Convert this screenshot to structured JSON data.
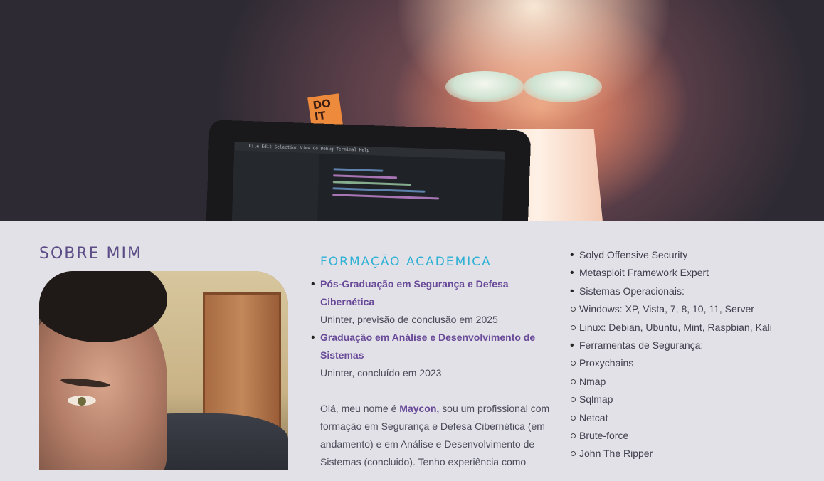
{
  "hero": {
    "postit_text": "DO IT",
    "editor_menu": "File  Edit  Selection  View  Go  Debug  Terminal  Help"
  },
  "about": {
    "title": "SOBRE MIM"
  },
  "education": {
    "title": "FORMAÇÃO ACADEMICA",
    "items": [
      {
        "degree": "Pós-Graduação em Segurança e Defesa Cibernética",
        "detail": "Uninter, previsão de conclusão em 2025"
      },
      {
        "degree": "Graduação em Análise e Desenvolvimento de Sistemas",
        "detail": "Uninter, concluído em 2023"
      }
    ],
    "bio_prefix": "Olá, meu nome é ",
    "bio_name": "Maycon,",
    "bio_rest": " sou um profissional com formação em Segurança e Defesa Cibernética (em andamento) e em Análise e Desenvolvimento de Sistemas (concluido). Tenho experiência como"
  },
  "skills": {
    "items": [
      {
        "text": "Solyd Offensive Security",
        "type": "disc"
      },
      {
        "text": "Metasploit Framework Expert",
        "type": "disc"
      },
      {
        "text": "Sistemas Operacionais:",
        "type": "disc"
      },
      {
        "text": "Windows: XP, Vista, 7, 8, 10, 11, Server",
        "type": "circle"
      },
      {
        "text": "Linux: Debian, Ubuntu, Mint, Raspbian, Kali",
        "type": "circle"
      },
      {
        "text": "Ferramentas de Segurança:",
        "type": "disc"
      },
      {
        "text": "Proxychains",
        "type": "circle"
      },
      {
        "text": "Nmap",
        "type": "circle"
      },
      {
        "text": "Sqlmap",
        "type": "circle"
      },
      {
        "text": "Netcat",
        "type": "circle"
      },
      {
        "text": "Brute-force",
        "type": "circle"
      },
      {
        "text": "John The Ripper",
        "type": "circle"
      }
    ]
  }
}
